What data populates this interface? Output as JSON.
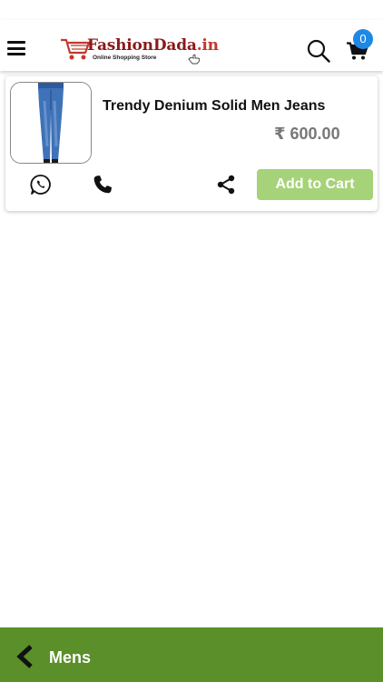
{
  "header": {
    "logo_brand": "FashionDada",
    "logo_tld": ".in",
    "logo_tagline": "Online Shopping Store",
    "cart_count": "0"
  },
  "product": {
    "title": "Trendy Denium Solid Men Jeans",
    "price": "₹ 600.00",
    "add_to_cart_label": "Add to Cart"
  },
  "footer": {
    "category": "Mens"
  },
  "colors": {
    "footer_bg": "#5a8f29",
    "add_to_cart_bg": "#a6d279",
    "badge_bg": "#1e88e5"
  },
  "icons": [
    "menu-icon",
    "search-icon",
    "cart-icon",
    "whatsapp-icon",
    "phone-icon",
    "share-icon",
    "back-chevron-icon"
  ]
}
